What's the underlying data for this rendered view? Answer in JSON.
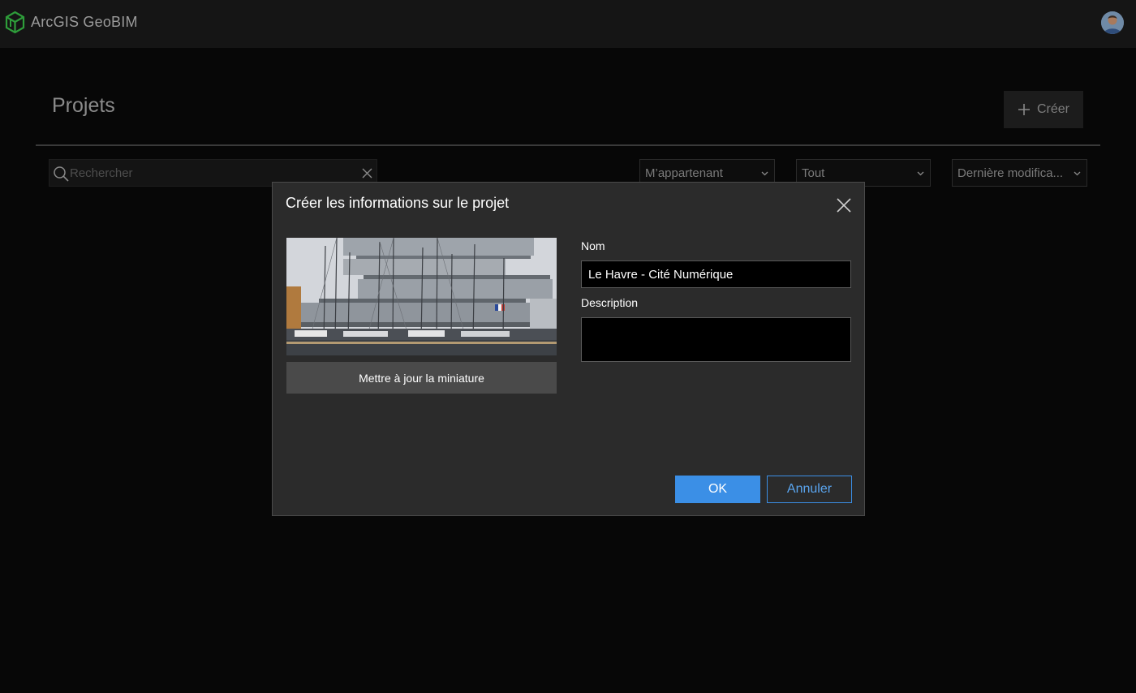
{
  "header": {
    "app_title": "ArcGIS GeoBIM",
    "logo_icon": "geobim-cube-icon",
    "avatar_icon": "user-avatar-icon"
  },
  "page": {
    "title": "Projets",
    "create_label": "Créer"
  },
  "search": {
    "placeholder": "Rechercher",
    "value": ""
  },
  "filters": {
    "owner": "M’appartenant",
    "type": "Tout",
    "sort": "Dernière modifica..."
  },
  "dialog": {
    "title": "Créer les informations sur le projet",
    "update_thumbnail_label": "Mettre à jour la miniature",
    "name_label": "Nom",
    "name_value": "Le Havre - Cité Numérique",
    "description_label": "Description",
    "description_value": "",
    "ok_label": "OK",
    "cancel_label": "Annuler"
  },
  "colors": {
    "accent": "#3b8fe6",
    "logo_green": "#2e9d3a",
    "modal_bg": "#2b2b2b",
    "page_bg": "#070707"
  }
}
